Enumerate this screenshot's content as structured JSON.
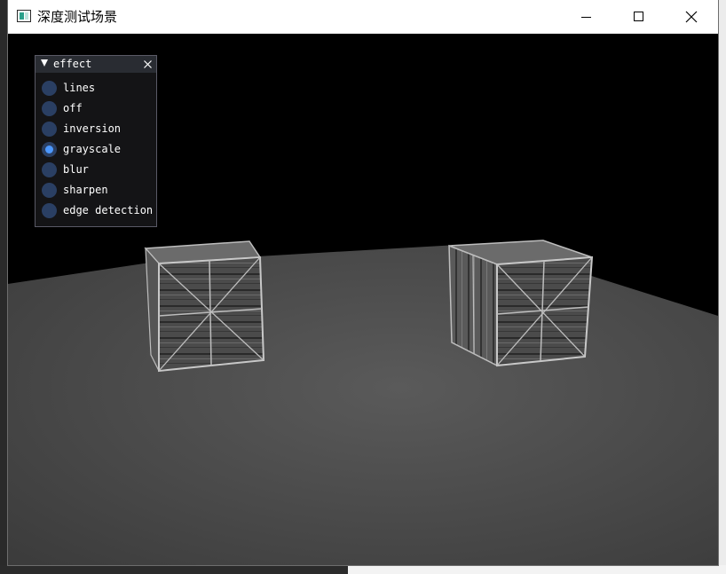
{
  "window": {
    "title": "深度测试场景"
  },
  "panel": {
    "title": "effect",
    "options": [
      {
        "label": "lines",
        "checked": false
      },
      {
        "label": "off",
        "checked": false
      },
      {
        "label": "inversion",
        "checked": false
      },
      {
        "label": "grayscale",
        "checked": true
      },
      {
        "label": "blur",
        "checked": false
      },
      {
        "label": "sharpen",
        "checked": false
      },
      {
        "label": "edge detection",
        "checked": false
      }
    ]
  },
  "colors": {
    "radio_off": "#2a3f63",
    "radio_on": "#4c98ff",
    "panel_header": "#292c32",
    "floor": "#4a4a4a",
    "sky": "#000000"
  }
}
